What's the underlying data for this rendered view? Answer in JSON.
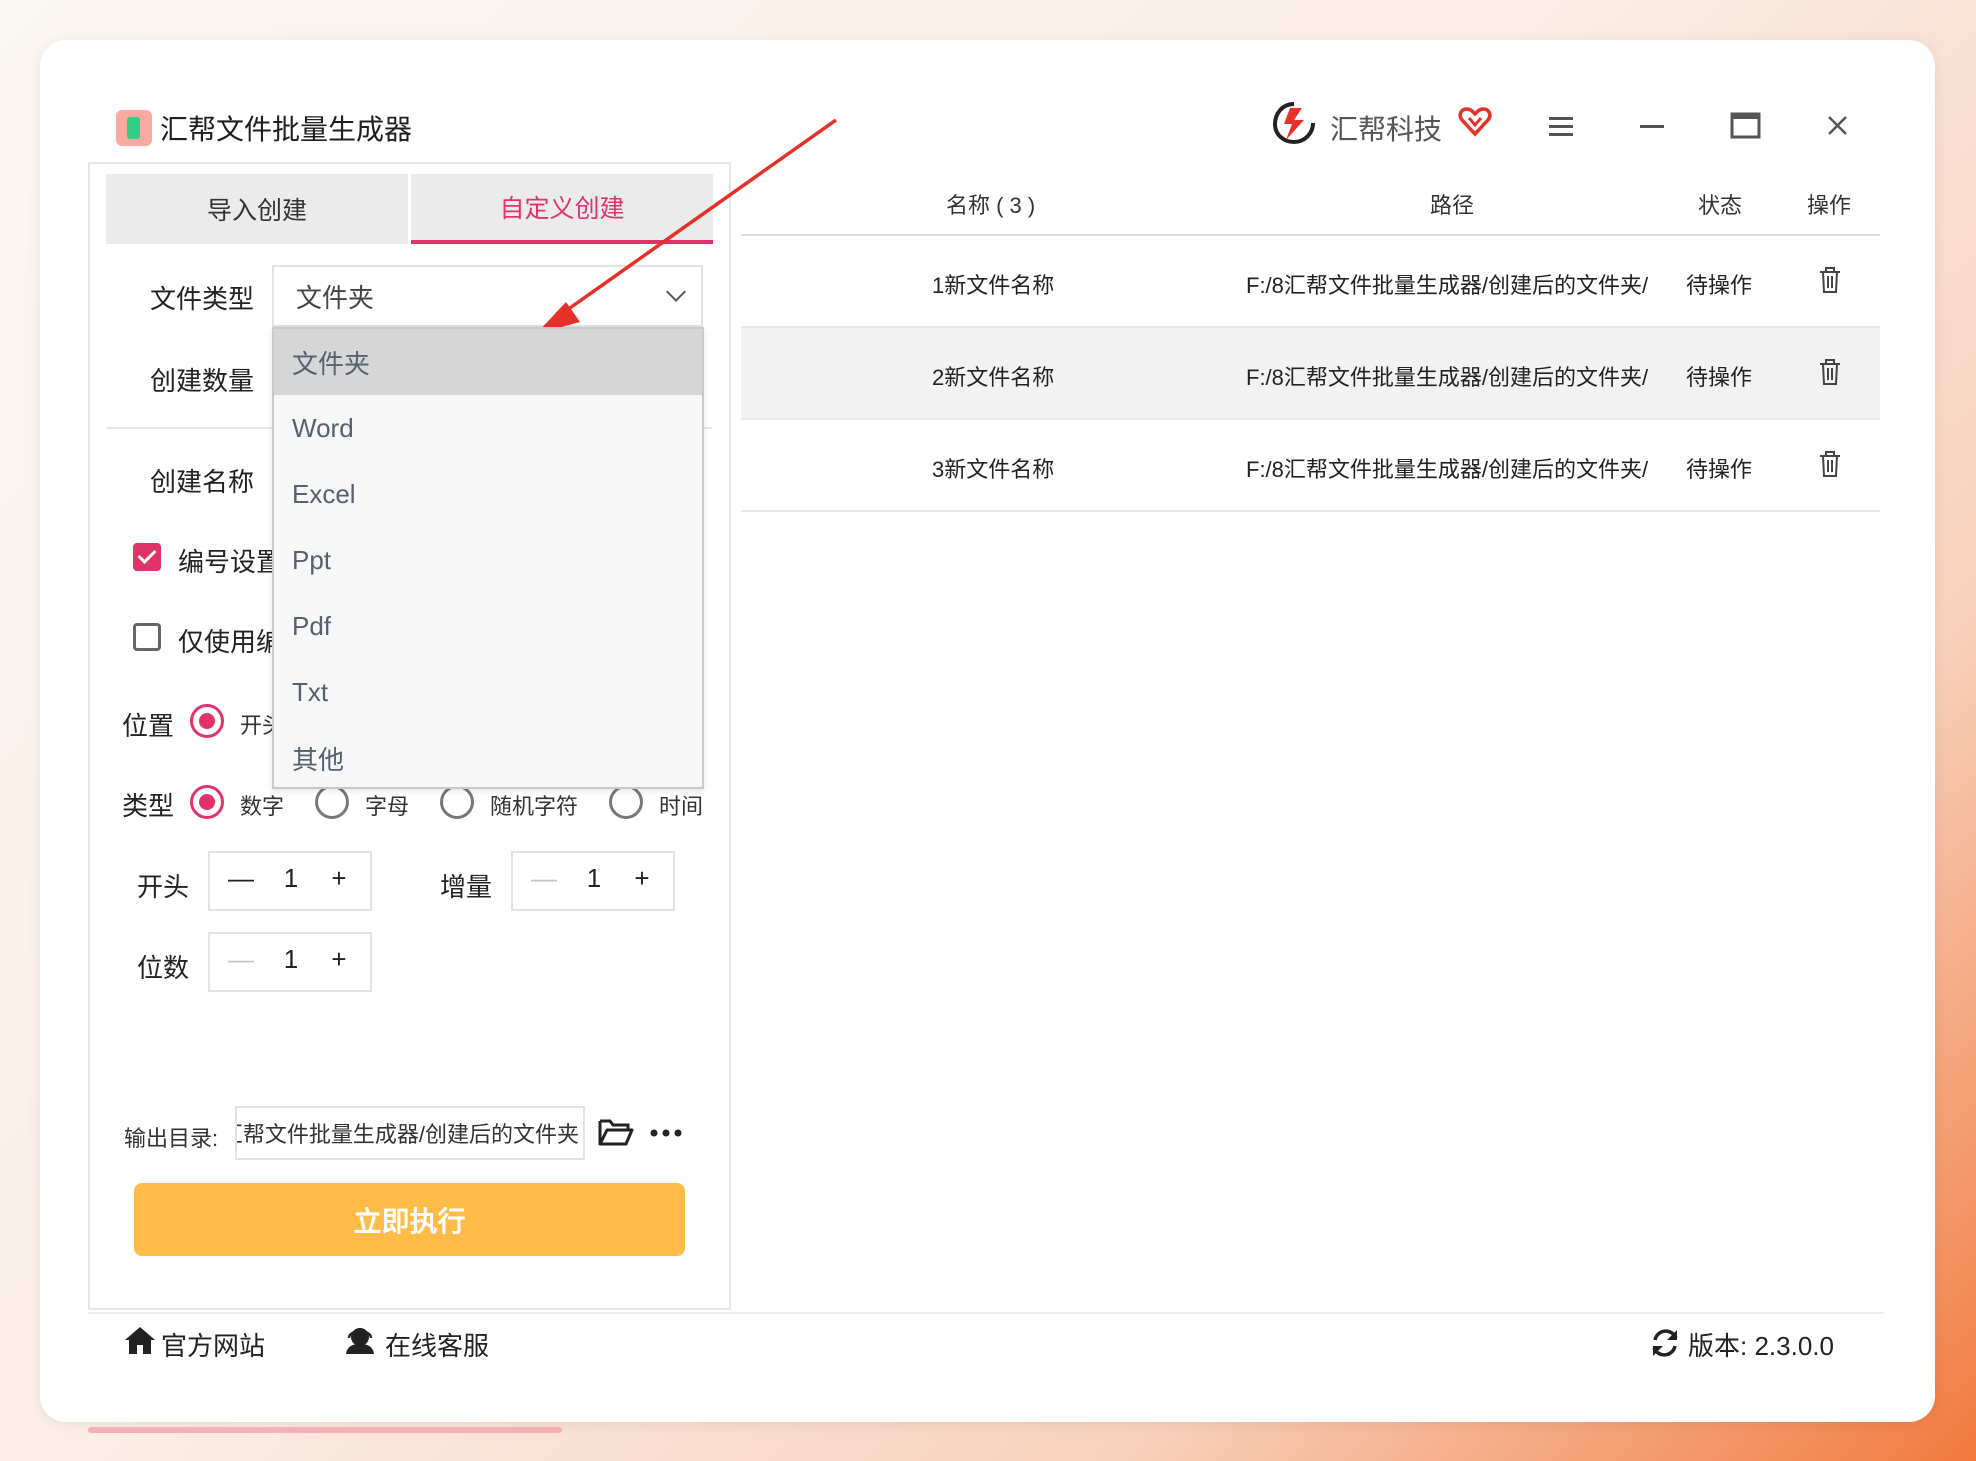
{
  "window": {
    "title": "汇帮文件批量生成器",
    "brand": "汇帮科技",
    "controls": [
      "menu",
      "minimize",
      "maximize",
      "close"
    ]
  },
  "tabs": [
    {
      "label": "导入创建",
      "active": false
    },
    {
      "label": "自定义创建",
      "active": true
    }
  ],
  "form": {
    "file_type_label": "文件类型",
    "file_type_value": "文件夹",
    "count_label": "创建数量",
    "name_label": "创建名称",
    "numbering_label": "编号设置",
    "numbering_checked": true,
    "only_number_label": "仅使用编",
    "only_number_checked": false,
    "position_label": "位置",
    "position_option": "开头",
    "type_label": "类型",
    "type_options": [
      {
        "label": "数字",
        "selected": true
      },
      {
        "label": "字母",
        "selected": false
      },
      {
        "label": "随机字符",
        "selected": false
      },
      {
        "label": "时间",
        "selected": false
      }
    ],
    "start_label": "开头",
    "start_value": "1",
    "increment_label": "增量",
    "increment_value": "1",
    "digits_label": "位数",
    "digits_value": "1",
    "output_label": "输出目录:",
    "output_value": "汇帮文件批量生成器/创建后的文件夹",
    "run_label": "立即执行"
  },
  "dropdown": {
    "options": [
      "文件夹",
      "Word",
      "Excel",
      "Ppt",
      "Pdf",
      "Txt",
      "其他"
    ],
    "selected": "文件夹"
  },
  "table": {
    "headers": {
      "name": "名称 ( 3 )",
      "path": "路径",
      "status": "状态",
      "action": "操作"
    },
    "rows": [
      {
        "name": "1新文件名称",
        "path": "F:/8汇帮文件批量生成器/创建后的文件夹/",
        "status": "待操作"
      },
      {
        "name": "2新文件名称",
        "path": "F:/8汇帮文件批量生成器/创建后的文件夹/",
        "status": "待操作"
      },
      {
        "name": "3新文件名称",
        "path": "F:/8汇帮文件批量生成器/创建后的文件夹/",
        "status": "待操作"
      }
    ]
  },
  "footer": {
    "website": "官方网站",
    "support": "在线客服",
    "version": "版本: 2.3.0.0"
  },
  "colors": {
    "accent": "#e0336a",
    "run_button": "#ffbb47",
    "annotation_arrow": "#e8302a"
  }
}
